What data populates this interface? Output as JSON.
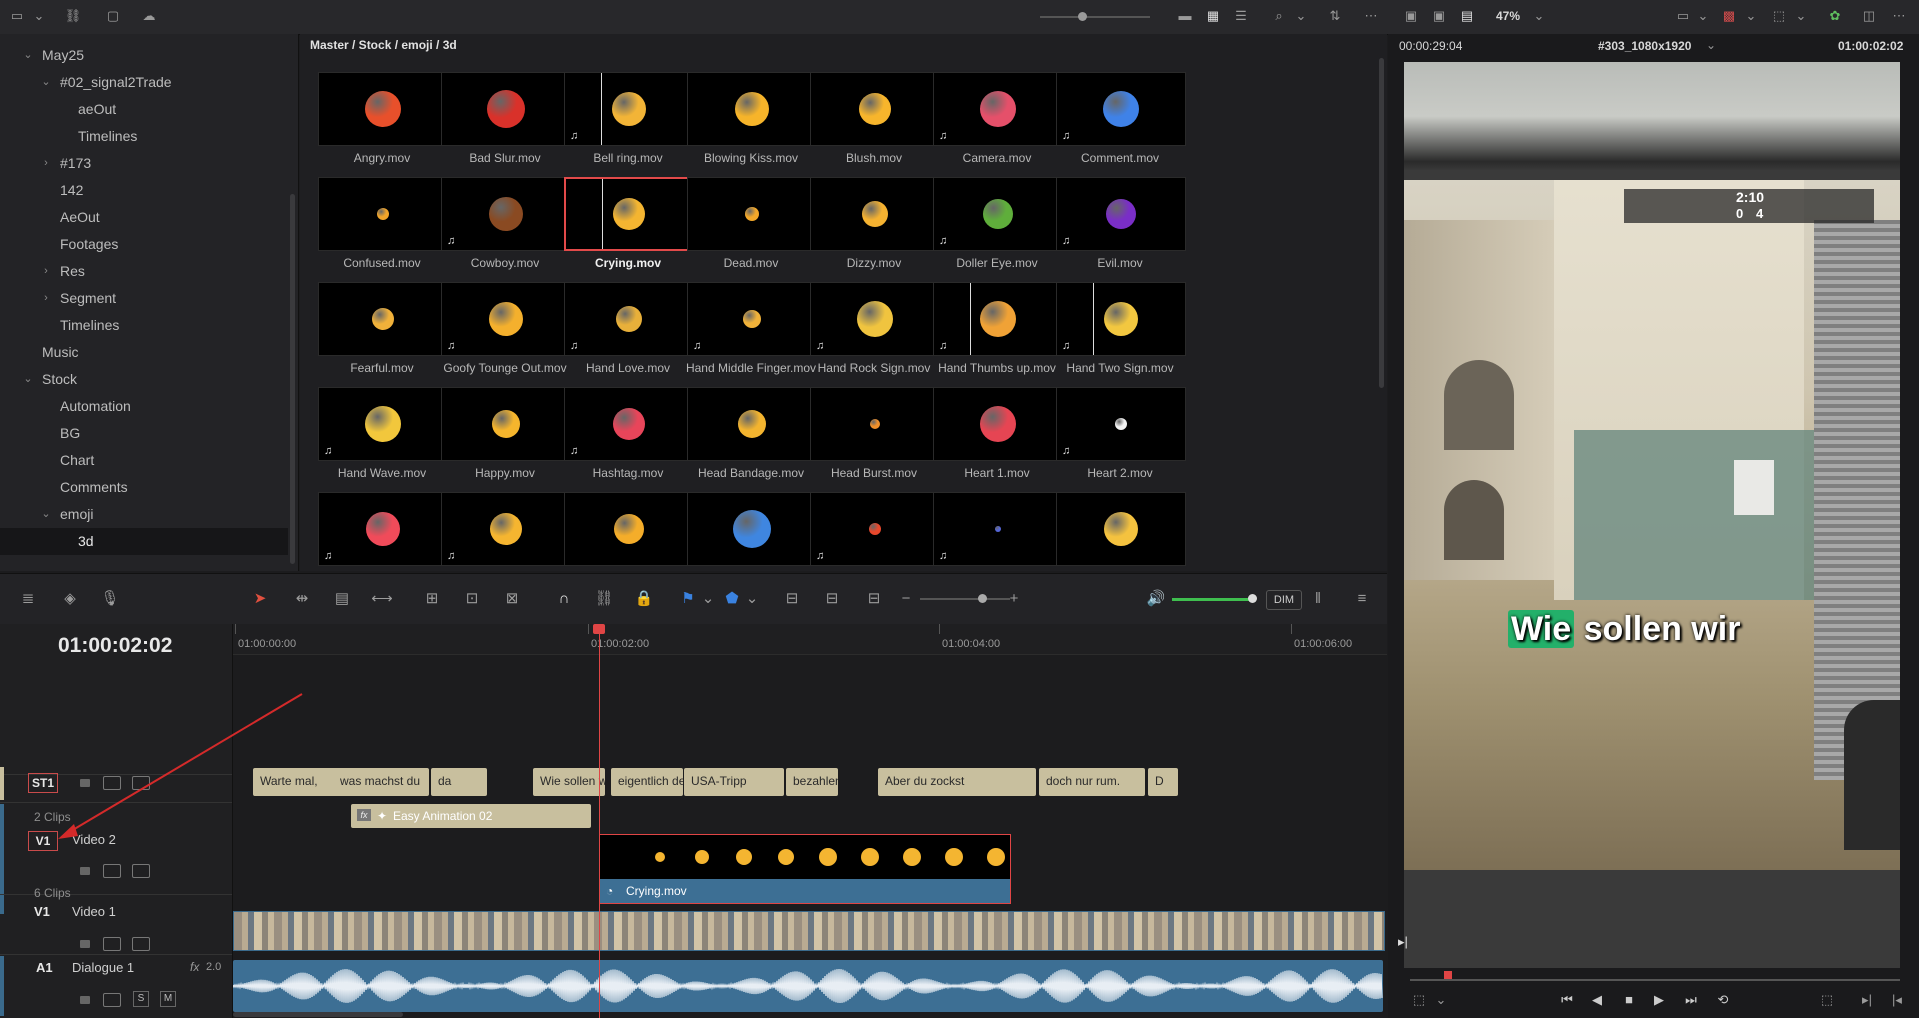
{
  "topbar": {
    "zoom": "47%"
  },
  "sidebar": {
    "items": [
      {
        "label": "May25",
        "indent": 1,
        "chevron": "down"
      },
      {
        "label": "#02_signal2Trade",
        "indent": 2,
        "chevron": "down"
      },
      {
        "label": "aeOut",
        "indent": 3,
        "chevron": ""
      },
      {
        "label": "Timelines",
        "indent": 3,
        "chevron": ""
      },
      {
        "label": "#173",
        "indent": 2,
        "chevron": "right"
      },
      {
        "label": "142",
        "indent": 2,
        "chevron": ""
      },
      {
        "label": "AeOut",
        "indent": 2,
        "chevron": ""
      },
      {
        "label": "Footages",
        "indent": 2,
        "chevron": ""
      },
      {
        "label": "Res",
        "indent": 2,
        "chevron": "right"
      },
      {
        "label": "Segment",
        "indent": 2,
        "chevron": "right"
      },
      {
        "label": "Timelines",
        "indent": 2,
        "chevron": ""
      },
      {
        "label": "Music",
        "indent": 1,
        "chevron": ""
      },
      {
        "label": "Stock",
        "indent": 1,
        "chevron": "down"
      },
      {
        "label": "Automation",
        "indent": 2,
        "chevron": ""
      },
      {
        "label": "BG",
        "indent": 2,
        "chevron": ""
      },
      {
        "label": "Chart",
        "indent": 2,
        "chevron": ""
      },
      {
        "label": "Comments",
        "indent": 2,
        "chevron": ""
      },
      {
        "label": "emoji",
        "indent": 2,
        "chevron": "down"
      },
      {
        "label": "3d",
        "indent": 3,
        "chevron": "",
        "selected": true
      }
    ]
  },
  "media": {
    "path": "Master / Stock / emoji / 3d",
    "clips": [
      {
        "name": "Angry.mov",
        "color": "#e8502b",
        "size": 36,
        "audio": false
      },
      {
        "name": "Bad Slur.mov",
        "color": "#d9312a",
        "size": 38,
        "audio": false
      },
      {
        "name": "Bell ring.mov",
        "color": "#f2b437",
        "size": 34,
        "audio": true,
        "bar": true
      },
      {
        "name": "Blowing Kiss.mov",
        "color": "#f6b42a",
        "size": 34,
        "audio": false
      },
      {
        "name": "Blush.mov",
        "color": "#f7b52c",
        "size": 32,
        "audio": false
      },
      {
        "name": "Camera.mov",
        "color": "#e5506a",
        "size": 36,
        "audio": true
      },
      {
        "name": "Comment.mov",
        "color": "#3f82e8",
        "size": 36,
        "audio": true
      },
      {
        "name": "Confused.mov",
        "color": "#f2a52a",
        "size": 12,
        "audio": false
      },
      {
        "name": "Cowboy.mov",
        "color": "#8a4a22",
        "size": 34,
        "audio": true
      },
      {
        "name": "Crying.mov",
        "color": "#f4b531",
        "size": 32,
        "audio": false,
        "selected": true,
        "bar": true
      },
      {
        "name": "Dead.mov",
        "color": "#f3a82a",
        "size": 14,
        "audio": false
      },
      {
        "name": "Dizzy.mov",
        "color": "#f5b231",
        "size": 26,
        "audio": false
      },
      {
        "name": "Doller Eye.mov",
        "color": "#5fae3b",
        "size": 30,
        "audio": true
      },
      {
        "name": "Evil.mov",
        "color": "#7a2ec7",
        "size": 30,
        "audio": true
      },
      {
        "name": "Fearful.mov",
        "color": "#f0b13a",
        "size": 22,
        "audio": false
      },
      {
        "name": "Goofy Tounge Out.mov",
        "color": "#f4b02d",
        "size": 34,
        "audio": true
      },
      {
        "name": "Hand Love.mov",
        "color": "#e8b03a",
        "size": 26,
        "audio": true
      },
      {
        "name": "Hand Middle Finger.mov",
        "color": "#f0b23a",
        "size": 18,
        "audio": true
      },
      {
        "name": "Hand Rock Sign.mov",
        "color": "#f0c43f",
        "size": 36,
        "audio": true
      },
      {
        "name": "Hand Thumbs up.mov",
        "color": "#f0a236",
        "size": 36,
        "audio": true,
        "bar": true
      },
      {
        "name": "Hand Two Sign.mov",
        "color": "#f2c740",
        "size": 34,
        "audio": true,
        "bar": true
      },
      {
        "name": "Hand Wave.mov",
        "color": "#f2c73c",
        "size": 36,
        "audio": true
      },
      {
        "name": "Happy.mov",
        "color": "#f5b52d",
        "size": 28,
        "audio": false
      },
      {
        "name": "Hashtag.mov",
        "color": "#e8455a",
        "size": 32,
        "audio": true
      },
      {
        "name": "Head Bandage.mov",
        "color": "#f3b42f",
        "size": 28,
        "audio": false
      },
      {
        "name": "Head Burst.mov",
        "color": "#f0902a",
        "size": 10,
        "audio": false
      },
      {
        "name": "Heart 1.mov",
        "color": "#e64553",
        "size": 36,
        "audio": false
      },
      {
        "name": "Heart 2.mov",
        "color": "#f2f2f2",
        "size": 12,
        "audio": true
      },
      {
        "name": "",
        "color": "#f04b5a",
        "size": 34,
        "audio": true
      },
      {
        "name": "",
        "color": "#f5b530",
        "size": 32,
        "audio": true
      },
      {
        "name": "",
        "color": "#f4ad2a",
        "size": 30,
        "audio": false
      },
      {
        "name": "",
        "color": "#3f86e0",
        "size": 38,
        "audio": false
      },
      {
        "name": "",
        "color": "#e8482c",
        "size": 12,
        "audio": true
      },
      {
        "name": "",
        "color": "#5566d8",
        "size": 6,
        "audio": true
      },
      {
        "name": "",
        "color": "#f4c23f",
        "size": 34,
        "audio": false
      }
    ]
  },
  "viewer": {
    "timecode_left": "00:00:29:04",
    "timeline_name": "#303_1080x1920",
    "timecode_right": "01:00:02:02",
    "subtitle_highlight": "Wie",
    "subtitle_rest": "sollen wir",
    "hud_score": "2:10",
    "hud_left": "0",
    "hud_right": "4"
  },
  "timeline": {
    "timecode": "01:00:02:02",
    "ruler": [
      "01:00:00:00",
      "01:00:02:00",
      "01:00:04:00",
      "01:00:06:00"
    ],
    "zoom_dim": "DIM",
    "subtitle_track": {
      "badge": "ST1"
    },
    "subtitles": [
      {
        "text": "Warte mal,"
      },
      {
        "text": "was machst du"
      },
      {
        "text": "da"
      },
      {
        "text": "Wie sollen wir"
      },
      {
        "text": "eigentlich den"
      },
      {
        "text": "USA-Tripp"
      },
      {
        "text": "bezahlen?"
      },
      {
        "text": "Aber du zockst"
      },
      {
        "text": "doch nur rum."
      },
      {
        "text": "D"
      }
    ],
    "video2": {
      "badge": "V1",
      "name": "Video 2",
      "clip_count": "2 Clips",
      "effect_clip": "Easy Animation 02",
      "effect_badge": "fx",
      "clip": "Crying.mov"
    },
    "video1": {
      "badge": "V1",
      "name": "Video 1",
      "clip_count": "6 Clips"
    },
    "audio1": {
      "badge": "A1",
      "name": "Dialogue 1",
      "fx": "fx",
      "level": "2.0",
      "s": "S",
      "m": "M"
    }
  }
}
